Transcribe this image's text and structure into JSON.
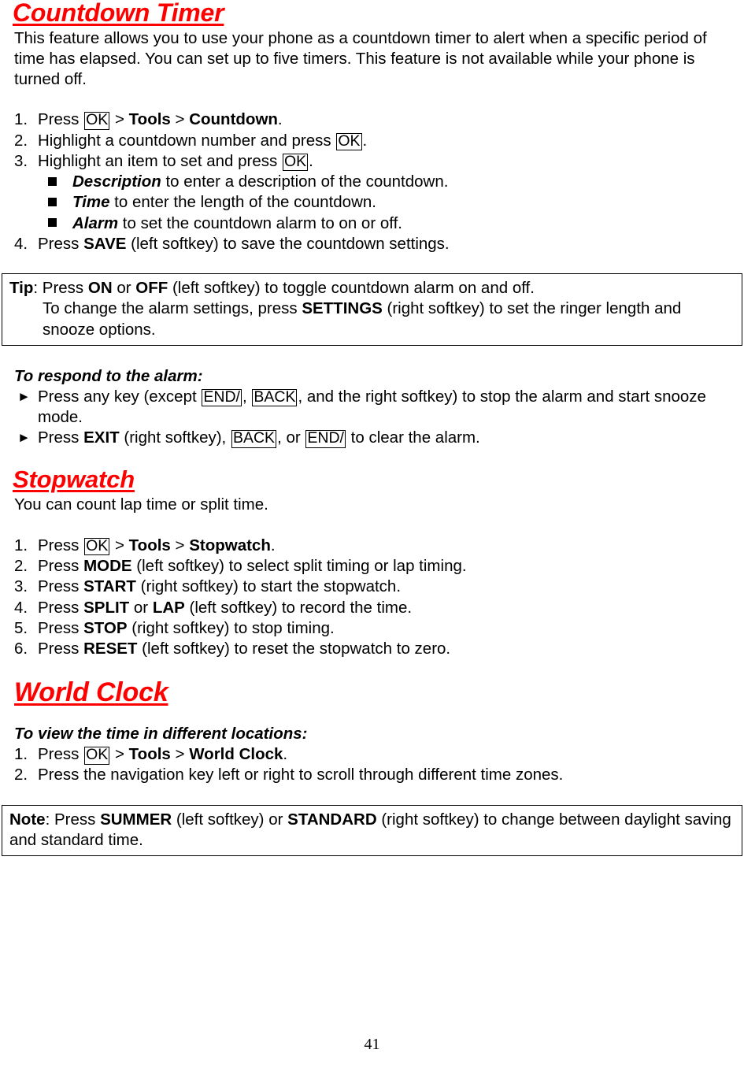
{
  "document": {
    "page_number": "41",
    "accent_color": "#FF0000",
    "text_color": "#000000"
  },
  "countdown": {
    "heading": "Countdown Timer",
    "intro": "This feature allows you to use your phone as a countdown timer to alert when a specific period of time has elapsed. You can set up to five timers. This feature is not available while your phone is turned off.",
    "steps": [
      {
        "num": "1.",
        "pre": "Press ",
        "key1": "OK",
        "mid1": " > ",
        "bold1": "Tools",
        "mid2": " > ",
        "bold2": "Countdown",
        "post": "."
      },
      {
        "num": "2.",
        "pre": "Highlight a countdown number and press ",
        "key1": "OK",
        "post": "."
      },
      {
        "num": "3.",
        "pre": "Highlight an item to set and press ",
        "key1": "OK",
        "post": "."
      },
      {
        "num": "4.",
        "pre": "Press ",
        "bold1": "SAVE",
        "post": " (left softkey) to save the countdown settings."
      }
    ],
    "sub_bullets": [
      {
        "bold": "Description",
        "text": " to enter a description of the countdown."
      },
      {
        "bold": "Time",
        "text": " to enter the length of the countdown."
      },
      {
        "bold": "Alarm",
        "text": " to set the countdown alarm to on or off."
      }
    ],
    "tip_box": {
      "label": "Tip",
      "line1_pre": ": Press ",
      "line1_bold1": "ON",
      "line1_mid": " or ",
      "line1_bold2": "OFF",
      "line1_post": " (left softkey) to toggle countdown alarm on and off.",
      "line2_pre": "To change the alarm settings, press ",
      "line2_bold": "SETTINGS",
      "line2_post": " (right softkey) to set the ringer length and snooze options."
    },
    "alarm_section": {
      "heading": "To respond to the alarm:",
      "items": [
        {
          "marker": "triangle-right-bullet",
          "pre": "Press any key (except ",
          "key1": "END/",
          "mid1": ", ",
          "key2": "BACK",
          "post": ", and the right softkey) to stop the alarm and start snooze mode."
        },
        {
          "marker": "triangle-right-bullet",
          "pre": "Press ",
          "bold1": "EXIT",
          "mid1": " (right softkey), ",
          "key1": "BACK",
          "mid2": ", or ",
          "key2": "END/",
          "post": " to clear the alarm."
        }
      ]
    }
  },
  "stopwatch": {
    "heading": "Stopwatch",
    "intro": "You can count lap time or split time.",
    "steps": [
      {
        "num": "1.",
        "pre": "Press ",
        "key1": "OK",
        "mid1": " > ",
        "bold1": "Tools",
        "mid2": " > ",
        "bold2": "Stopwatch",
        "post": "."
      },
      {
        "num": "2.",
        "pre": "Press ",
        "bold1": "MODE",
        "post": " (left softkey) to select split timing or lap timing."
      },
      {
        "num": "3.",
        "pre": "Press ",
        "bold1": "START",
        "post": " (right softkey) to start the stopwatch."
      },
      {
        "num": "4.",
        "pre": "Press ",
        "bold1": "SPLIT",
        "mid1": " or ",
        "bold2": "LAP",
        "post": " (left softkey) to record the time."
      },
      {
        "num": "5.",
        "pre": "Press ",
        "bold1": "STOP",
        "post": " (right softkey) to stop timing."
      },
      {
        "num": "6.",
        "pre": "Press ",
        "bold1": "RESET",
        "post": " (left softkey) to reset the stopwatch to zero."
      }
    ]
  },
  "world_clock": {
    "heading": "World Clock",
    "sub_heading": "To view the time in different locations:",
    "steps": [
      {
        "num": "1.",
        "pre": "Press ",
        "key1": "OK",
        "mid1": " > ",
        "bold1": "Tools",
        "mid2": " > ",
        "bold2": "World Clock",
        "post": "."
      },
      {
        "num": "2.",
        "pre": "Press the navigation key left or right to scroll through different time zones."
      }
    ],
    "note_box": {
      "label": "Note",
      "line_pre": ": Press ",
      "bold1": "SUMMER",
      "mid1": " (left softkey) or ",
      "bold2": "STANDARD",
      "post": " (right softkey) to change between daylight saving and standard time."
    }
  }
}
